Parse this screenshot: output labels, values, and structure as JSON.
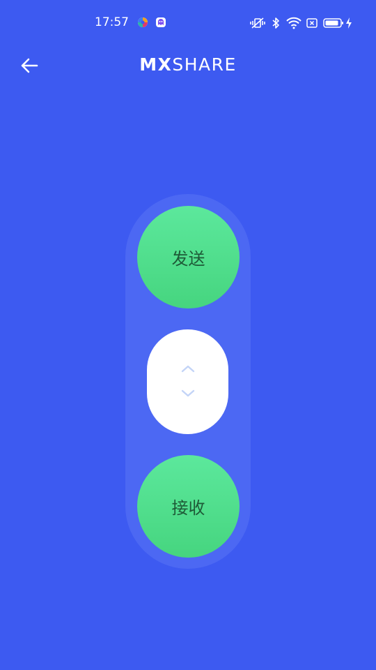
{
  "status_bar": {
    "time": "17:57",
    "icons": [
      "app-notification-icon",
      "ghost-app-icon",
      "vibrate-icon",
      "bluetooth-icon",
      "wifi-icon",
      "no-sim-icon",
      "battery-icon",
      "charging-icon"
    ]
  },
  "app_bar": {
    "back_icon": "arrow-left-icon",
    "title_bold": "MX",
    "title_light": "SHARE"
  },
  "actions": {
    "send_label": "发送",
    "receive_label": "接收"
  },
  "toggle": {
    "icons": [
      "chevron-up-icon",
      "chevron-down-icon"
    ]
  },
  "colors": {
    "background": "#3d5af1",
    "pill": "#4c68f3",
    "button_green": "#52df8e",
    "button_text": "#1e5a37",
    "chevron": "#c3d4f7"
  }
}
